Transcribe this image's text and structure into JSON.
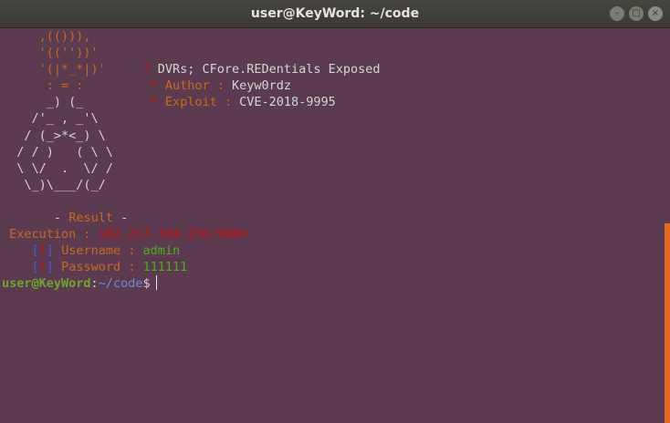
{
  "window": {
    "title": "user@KeyWord: ~/code",
    "minimize_glyph": "–",
    "maximize_glyph": "□",
    "close_glyph": "×"
  },
  "art": [
    "     ,(())),",
    "     '((''))'",
    "     '(|*_*|)'",
    "      : = :",
    "      _) (_",
    "    /'_ , _'\\",
    "   / (_>*<_) \\",
    "  / / )   ( \\ \\",
    "  \\ \\/  .  \\/ /",
    "   \\_)\\___/(_/"
  ],
  "info": {
    "line1_bullet": "*",
    "line1_text": "DVRs; CFore.REDentials Exposed",
    "line2_bullet": "*",
    "line2_label": "Author :",
    "line2_value": "Keyw0rdz",
    "line3_bullet": "*",
    "line3_label": "Exploit :",
    "line3_value": "CVE-2018-9995"
  },
  "result": {
    "header_dash_left": "-",
    "header_label": "Result",
    "header_dash_right": "-",
    "execution_label": "Execution :",
    "execution_value": "182.217.104.230:9000",
    "username_bracket_open": "[",
    "username_mark": "!",
    "username_bracket_close": "]",
    "username_label": "Username :",
    "username_value": "admin",
    "password_bracket_open": "[",
    "password_mark": "!",
    "password_bracket_close": "]",
    "password_label": "Password :",
    "password_value": "111111"
  },
  "prompt": {
    "user_host": "user@KeyWord",
    "colon": ":",
    "path": "~/code",
    "symbol": "$"
  },
  "colors": {
    "background": "#5c3a50",
    "orange": "#c36b1f",
    "red": "#c80f0f",
    "green": "#4cae1a",
    "blue": "#3c5fd8"
  }
}
